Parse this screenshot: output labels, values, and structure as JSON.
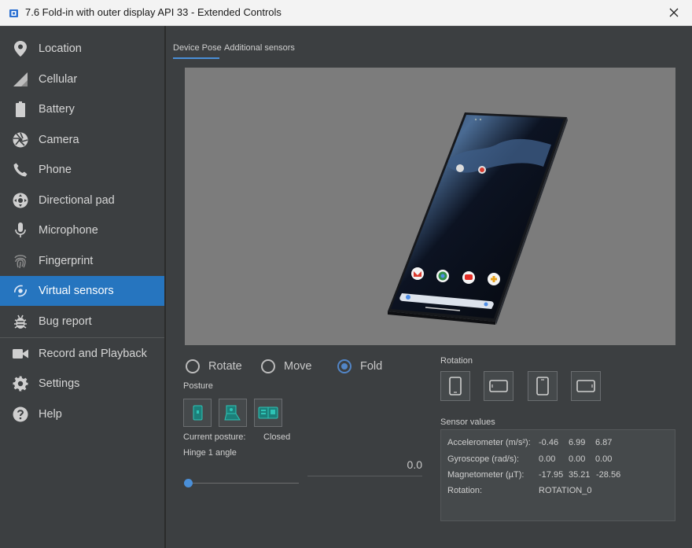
{
  "window": {
    "title": "7.6  Fold-in with outer display API 33 - Extended Controls"
  },
  "sidebar": {
    "items": [
      {
        "label": "Location",
        "icon": "location-pin-icon"
      },
      {
        "label": "Cellular",
        "icon": "cellular-signal-icon"
      },
      {
        "label": "Battery",
        "icon": "battery-icon"
      },
      {
        "label": "Camera",
        "icon": "camera-aperture-icon"
      },
      {
        "label": "Phone",
        "icon": "phone-icon"
      },
      {
        "label": "Directional pad",
        "icon": "dpad-icon"
      },
      {
        "label": "Microphone",
        "icon": "microphone-icon"
      },
      {
        "label": "Fingerprint",
        "icon": "fingerprint-icon"
      },
      {
        "label": "Virtual sensors",
        "icon": "virtual-sensors-icon",
        "active": true
      },
      {
        "label": "Bug report",
        "icon": "bug-icon"
      },
      {
        "label": "Record and Playback",
        "icon": "video-camera-icon"
      },
      {
        "label": "Settings",
        "icon": "gear-icon"
      },
      {
        "label": "Help",
        "icon": "help-icon"
      }
    ]
  },
  "tabs": [
    {
      "label": "Device Pose",
      "active": true
    },
    {
      "label": "Additional sensors",
      "active": false
    }
  ],
  "mode": {
    "options": [
      {
        "label": "Rotate",
        "checked": false
      },
      {
        "label": "Move",
        "checked": false
      },
      {
        "label": "Fold",
        "checked": true
      }
    ]
  },
  "posture": {
    "section_label": "Posture",
    "current_label": "Current posture:",
    "current_value": "Closed",
    "hinge_label": "Hinge 1 angle",
    "hinge_value": "0.0",
    "hinge_fraction": 0.0
  },
  "rotation": {
    "section_label": "Rotation"
  },
  "sensors": {
    "section_label": "Sensor values",
    "rows": [
      {
        "name": "Accelerometer (m/s²):",
        "values": [
          "-0.46",
          "6.99",
          "6.87"
        ]
      },
      {
        "name": "Gyroscope (rad/s):",
        "values": [
          "0.00",
          "0.00",
          "0.00"
        ]
      },
      {
        "name": "Magnetometer (µT):",
        "values": [
          "-17.95",
          "35.21",
          "-28.56"
        ]
      },
      {
        "name": "Rotation:",
        "values": [
          "ROTATION_0"
        ]
      }
    ]
  },
  "colors": {
    "accent": "#2675bf",
    "radio_checked": "#5285c6",
    "sidebar_bg": "#3c3f41",
    "viewport_bg": "#7c7c7c"
  }
}
